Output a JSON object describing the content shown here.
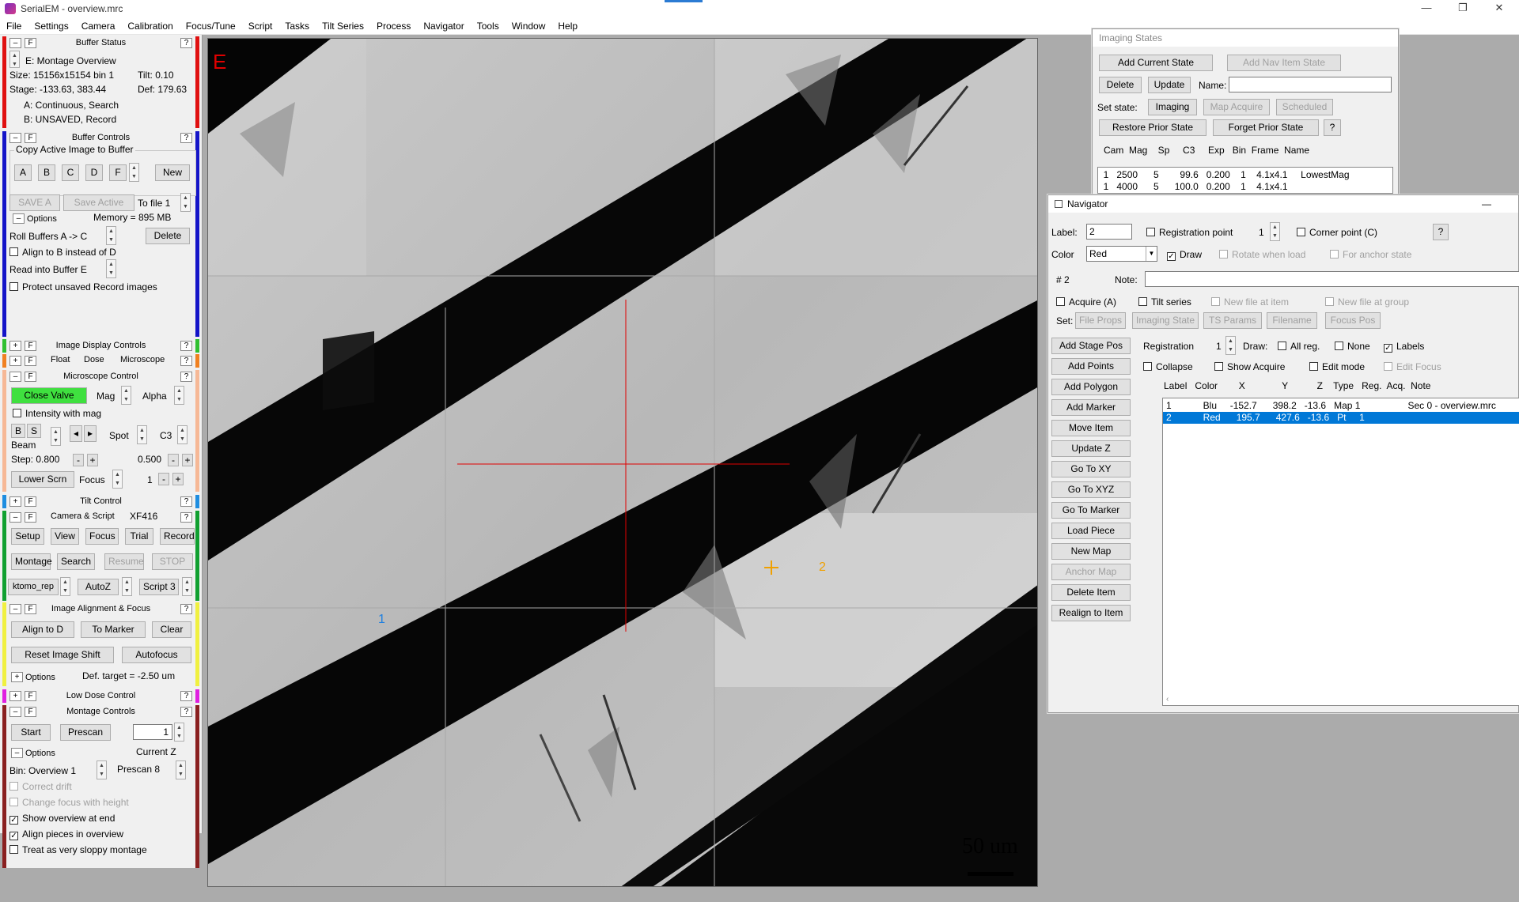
{
  "window": {
    "title": "SerialEM - overview.mrc",
    "min": "—",
    "restore": "❐",
    "close": "✕"
  },
  "menu": [
    "File",
    "Settings",
    "Camera",
    "Calibration",
    "Focus/Tune",
    "Script",
    "Tasks",
    "Tilt Series",
    "Process",
    "Navigator",
    "Tools",
    "Window",
    "Help"
  ],
  "buffer_status": {
    "title": "Buffer Status",
    "line1": "E: Montage Overview",
    "size": "Size: 15156x15154  bin 1",
    "tilt": "Tilt: 0.10",
    "stage": "Stage: -133.63, 383.44",
    "def": "Def: 179.63",
    "a": "A: Continuous, Search",
    "b": "B: UNSAVED, Record"
  },
  "buffer_controls": {
    "title": "Buffer Controls",
    "copy": "Copy Active Image to Buffer",
    "buffers": [
      "A",
      "B",
      "C",
      "D",
      "F"
    ],
    "new": "New",
    "save_a": "SAVE A",
    "save_active": "Save Active",
    "to_file": "To file 1",
    "options": "Options",
    "memory": "Memory = 895 MB",
    "roll": "Roll Buffers A -> C",
    "delete": "Delete",
    "align_b": "Align to B instead of D",
    "read_into": "Read into Buffer  E",
    "protect": "Protect unsaved Record images"
  },
  "image_display": {
    "title": "Image Display Controls"
  },
  "float_row": {
    "float": "Float",
    "dose": "Dose",
    "micro": "Microscope"
  },
  "microscope": {
    "title": "Microscope Control",
    "close_valve": "Close Valve",
    "mag": "Mag",
    "alpha": "Alpha",
    "intensity": "Intensity with mag",
    "b": "B",
    "s": "S",
    "beam": "Beam",
    "spot": "Spot",
    "c3": "C3",
    "step": "Step:  0.800",
    "step2": "0.500",
    "lower": "Lower Scrn",
    "focus": "Focus",
    "focus_val": "1"
  },
  "tilt_control": {
    "title": "Tilt Control"
  },
  "camera": {
    "title": "Camera & Script",
    "cam": "XF416",
    "setup": "Setup",
    "view": "View",
    "focus": "Focus",
    "trial": "Trial",
    "record": "Record",
    "montage": "Montage",
    "search": "Search",
    "resume": "Resume",
    "stop": "STOP",
    "script_sel": "ktomo_rep",
    "autoz": "AutoZ",
    "script3": "Script 3"
  },
  "alignment": {
    "title": "Image Alignment & Focus",
    "align_d": "Align to D",
    "to_marker": "To Marker",
    "clear": "Clear",
    "reset": "Reset Image Shift",
    "autofocus": "Autofocus",
    "options": "Options",
    "def_target": "Def. target = -2.50 um"
  },
  "low_dose": {
    "title": "Low Dose Control"
  },
  "montage": {
    "title": "Montage Controls",
    "start": "Start",
    "prescan": "Prescan",
    "spin_val": "1",
    "current_z": "Current Z",
    "options": "Options",
    "bin": "Bin: Overview 1",
    "prescan8": "Prescan 8",
    "correct": "Correct drift",
    "change": "Change focus with height",
    "show": "Show overview at end",
    "align": "Align pieces in overview",
    "sloppy": "Treat as very sloppy montage"
  },
  "image": {
    "buffer_letter": "E",
    "scale": "50 um",
    "marker1": "1",
    "marker2": "2"
  },
  "imaging_states": {
    "title": "Imaging States",
    "add_current": "Add Current State",
    "add_nav": "Add Nav Item State",
    "delete": "Delete",
    "update": "Update",
    "name_lbl": "Name:",
    "set_state": "Set state:",
    "imaging": "Imaging",
    "map_acquire": "Map Acquire",
    "scheduled": "Scheduled",
    "restore": "Restore Prior State",
    "forget": "Forget Prior State",
    "help": "?",
    "header": "Cam  Mag    Sp     C3     Exp   Bin  Frame  Name",
    "rows": [
      "  1   2500      5        99.6   0.200    1    4.1x4.1     LowestMag",
      "  1   4000      5      100.0   0.200    1    4.1x4.1"
    ]
  },
  "navigator": {
    "title": "Navigator",
    "label_lbl": "Label:",
    "label_val": "2",
    "reg_point": "Registration point",
    "reg_num": "1",
    "corner": "Corner point (C)",
    "help": "?",
    "color_lbl": "Color",
    "color_val": "Red",
    "draw": "Draw",
    "rotate": "Rotate when load",
    "anchor_state": "For anchor state",
    "num": "# 2",
    "note_lbl": "Note:",
    "acquire": "Acquire (A)",
    "tilt_series": "Tilt series",
    "new_file_item": "New file at item",
    "new_file_group": "New file at group",
    "set": "Set:",
    "file_props": "File Props",
    "imaging_state": "Imaging State",
    "ts_params": "TS Params",
    "filename": "Filename",
    "focus_pos": "Focus Pos",
    "add_stage": "Add Stage Pos",
    "registration": "Registration",
    "reg_val": "1",
    "draw_lbl": "Draw:",
    "all_reg": "All reg.",
    "none": "None",
    "labels": "Labels",
    "add_points": "Add Points",
    "collapse": "Collapse",
    "show_acquire": "Show Acquire",
    "edit_mode": "Edit mode",
    "edit_focus": "Edit Focus",
    "add_polygon": "Add Polygon",
    "add_marker": "Add Marker",
    "move_item": "Move Item",
    "update_z": "Update Z",
    "go_xy": "Go To XY",
    "go_xyz": "Go To XYZ",
    "go_marker": "Go To Marker",
    "load_piece": "Load Piece",
    "new_map": "New Map",
    "anchor_map": "Anchor Map",
    "delete_item": "Delete Item",
    "realign": "Realign to Item",
    "list_header": "Label   Color        X              Y           Z    Type   Reg.  Acq.  Note",
    "rows": [
      "1            Blu     -152.7      398.2   -13.6   Map 1                  Sec 0 - overview.mrc",
      "2            Red      195.7      427.6   -13.6   Pt     1"
    ]
  }
}
